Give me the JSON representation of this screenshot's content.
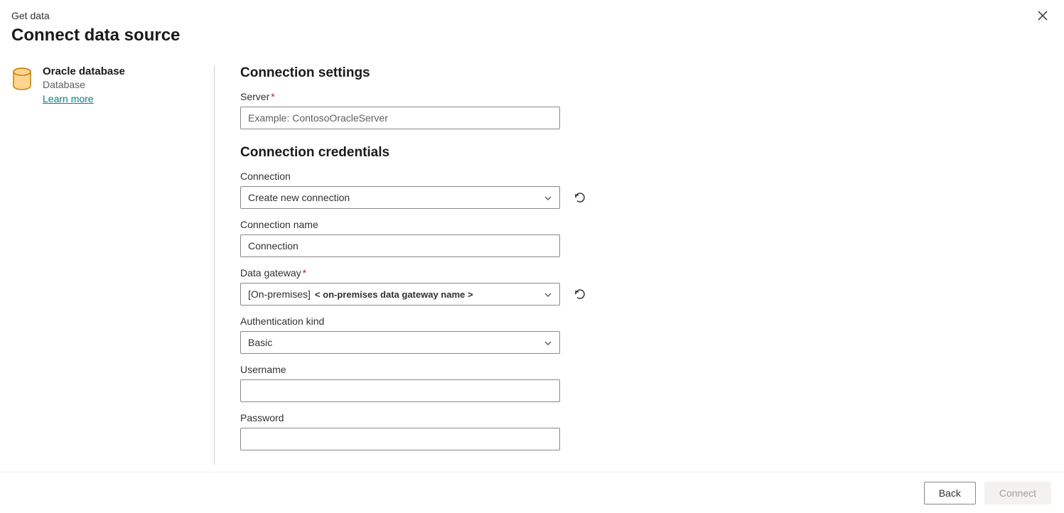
{
  "header": {
    "breadcrumb": "Get data",
    "title": "Connect data source"
  },
  "sidebar": {
    "source_name": "Oracle database",
    "source_type": "Database",
    "learn_more": "Learn more"
  },
  "main": {
    "section_settings": "Connection settings",
    "server": {
      "label": "Server",
      "placeholder": "Example: ContosoOracleServer",
      "value": ""
    },
    "section_credentials": "Connection credentials",
    "connection": {
      "label": "Connection",
      "value": "Create new connection"
    },
    "connection_name": {
      "label": "Connection name",
      "value": "Connection"
    },
    "gateway": {
      "label": "Data gateway",
      "prefix": "[On-premises]",
      "sub": "< on-premises data gateway name >"
    },
    "auth_kind": {
      "label": "Authentication kind",
      "value": "Basic"
    },
    "username": {
      "label": "Username",
      "value": ""
    },
    "password": {
      "label": "Password",
      "value": ""
    }
  },
  "footer": {
    "back": "Back",
    "connect": "Connect"
  }
}
